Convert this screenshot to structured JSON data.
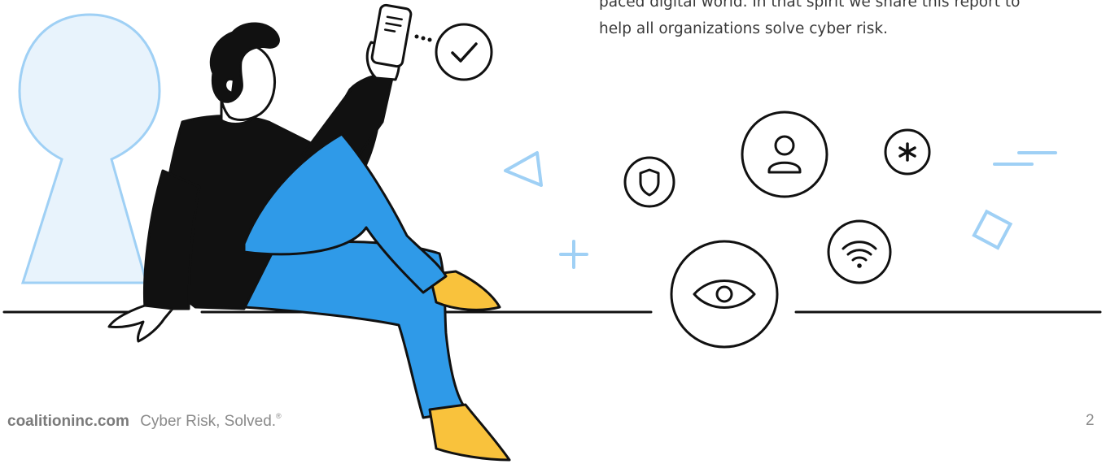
{
  "intro": {
    "line1": "paced digital world. In that spirit we share this report to",
    "line2": "help all organizations solve cyber risk."
  },
  "footer": {
    "site": "coalitioninc.com",
    "tagline": "Cyber Risk, Solved.",
    "trademark": "®",
    "page_number": "2"
  },
  "colors": {
    "ink": "#111111",
    "accent_light_blue": "#9fd0f5",
    "jeans_blue": "#2f9ae8",
    "shoe_yellow": "#f9c23c",
    "keyhole_fill": "#e8f3fc"
  },
  "icons": [
    "shield-icon",
    "user-icon",
    "asterisk-icon",
    "wifi-icon",
    "eye-icon",
    "check-icon",
    "phone-icon",
    "keyhole-icon"
  ]
}
